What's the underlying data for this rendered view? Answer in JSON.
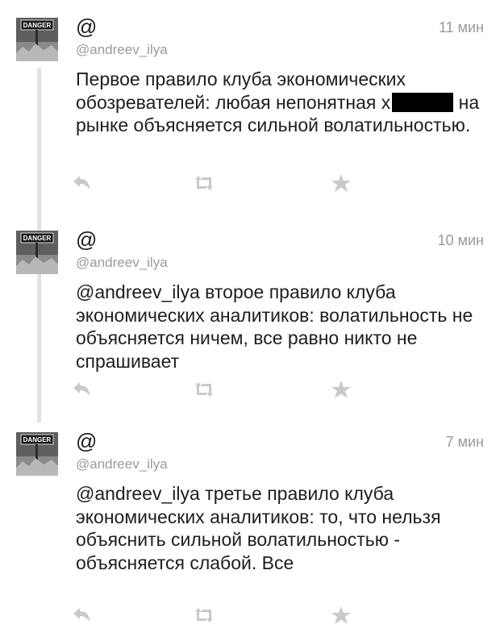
{
  "tweets": [
    {
      "name": "@",
      "handle": "@andreev_ilya",
      "time": "11 мин",
      "text": "Первое правило клуба экономических обозревателей: любая непонятная х",
      "text_tail": "на рынке объясняется сильной волатильностью.",
      "avatar_label": "DANGER"
    },
    {
      "name": "@",
      "handle": "@andreev_ilya",
      "time": "10 мин",
      "text": "@andreev_ilya второе правило клуба экономических аналитиков: волатильность не объясняется ничем, все равно никто не спрашивает",
      "avatar_label": "DANGER"
    },
    {
      "name": "@",
      "handle": "@andreev_ilya",
      "time": "7 мин",
      "text": "@andreev_ilya третье правило клуба экономических аналитиков: то, что нельзя объяснить сильной волатильностью - объясняется слабой. Все",
      "avatar_label": "DANGER"
    }
  ],
  "icons": {
    "reply": "reply-icon",
    "retweet": "retweet-icon",
    "favorite": "star-icon"
  },
  "colors": {
    "icon_gray": "#c9c9c9",
    "meta_gray": "#9a9a9a",
    "thread_line": "#e2e2e2"
  }
}
